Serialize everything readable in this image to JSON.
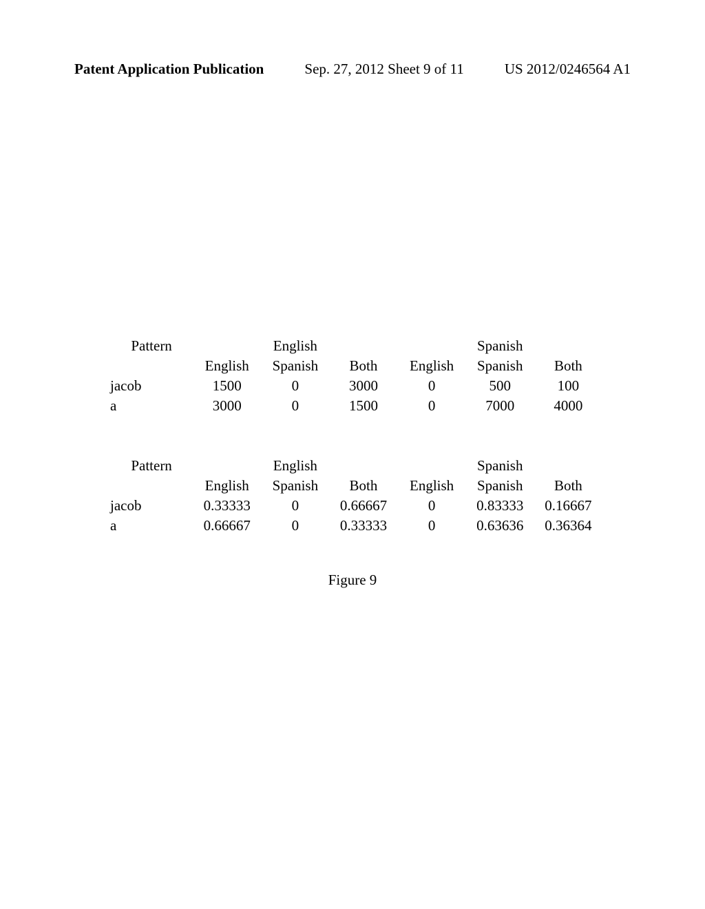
{
  "header": {
    "left": "Patent Application Publication",
    "center": "Sep. 27, 2012  Sheet 9 of 11",
    "right": "US 2012/0246564 A1"
  },
  "table1": {
    "group_row": {
      "pattern": "Pattern",
      "english": "English",
      "spanish": "Spanish"
    },
    "sub_row": {
      "c1": "English",
      "c2": "Spanish",
      "c3": "Both",
      "c4": "English",
      "c5": "Spanish",
      "c6": "Both"
    },
    "rows": [
      {
        "pattern": "jacob",
        "c1": "1500",
        "c2": "0",
        "c3": "3000",
        "c4": "0",
        "c5": "500",
        "c6": "100"
      },
      {
        "pattern": "a",
        "c1": "3000",
        "c2": "0",
        "c3": "1500",
        "c4": "0",
        "c5": "7000",
        "c6": "4000"
      }
    ]
  },
  "table2": {
    "group_row": {
      "pattern": "Pattern",
      "english": "English",
      "spanish": "Spanish"
    },
    "sub_row": {
      "c1": "English",
      "c2": "Spanish",
      "c3": "Both",
      "c4": "English",
      "c5": "Spanish",
      "c6": "Both"
    },
    "rows": [
      {
        "pattern": "jacob",
        "c1": "0.33333",
        "c2": "0",
        "c3": "0.66667",
        "c4": "0",
        "c5": "0.83333",
        "c6": "0.16667"
      },
      {
        "pattern": "a",
        "c1": "0.66667",
        "c2": "0",
        "c3": "0.33333",
        "c4": "0",
        "c5": "0.63636",
        "c6": "0.36364"
      }
    ]
  },
  "figure_caption": "Figure 9"
}
